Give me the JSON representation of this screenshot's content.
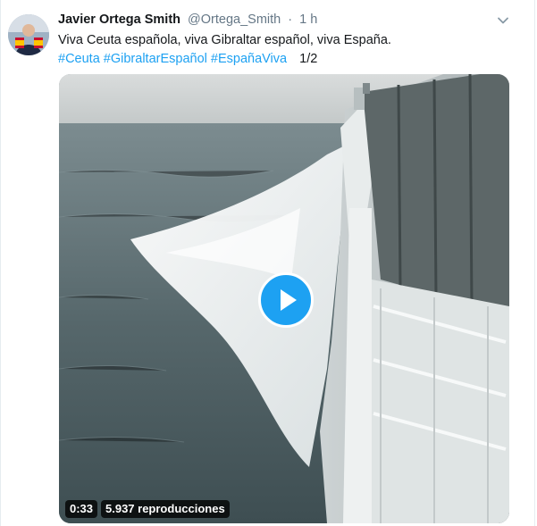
{
  "tweet": {
    "author_name": "Javier Ortega Smith",
    "handle": "@Ortega_Smith",
    "separator": "·",
    "time": "1 h",
    "text": "Viva Ceuta española, viva Gibraltar español, viva España.",
    "hashtags": [
      "#Ceuta",
      "#GibraltarEspañol",
      "#EspañaViva"
    ],
    "thread_count": "1/2"
  },
  "video": {
    "duration": "0:33",
    "views": "5.937 reproducciones"
  },
  "icons": {
    "caret": "chevron-down-icon",
    "play": "play-icon"
  },
  "colors": {
    "accent": "#1da1f2",
    "text": "#14171a",
    "secondary": "#657786"
  }
}
